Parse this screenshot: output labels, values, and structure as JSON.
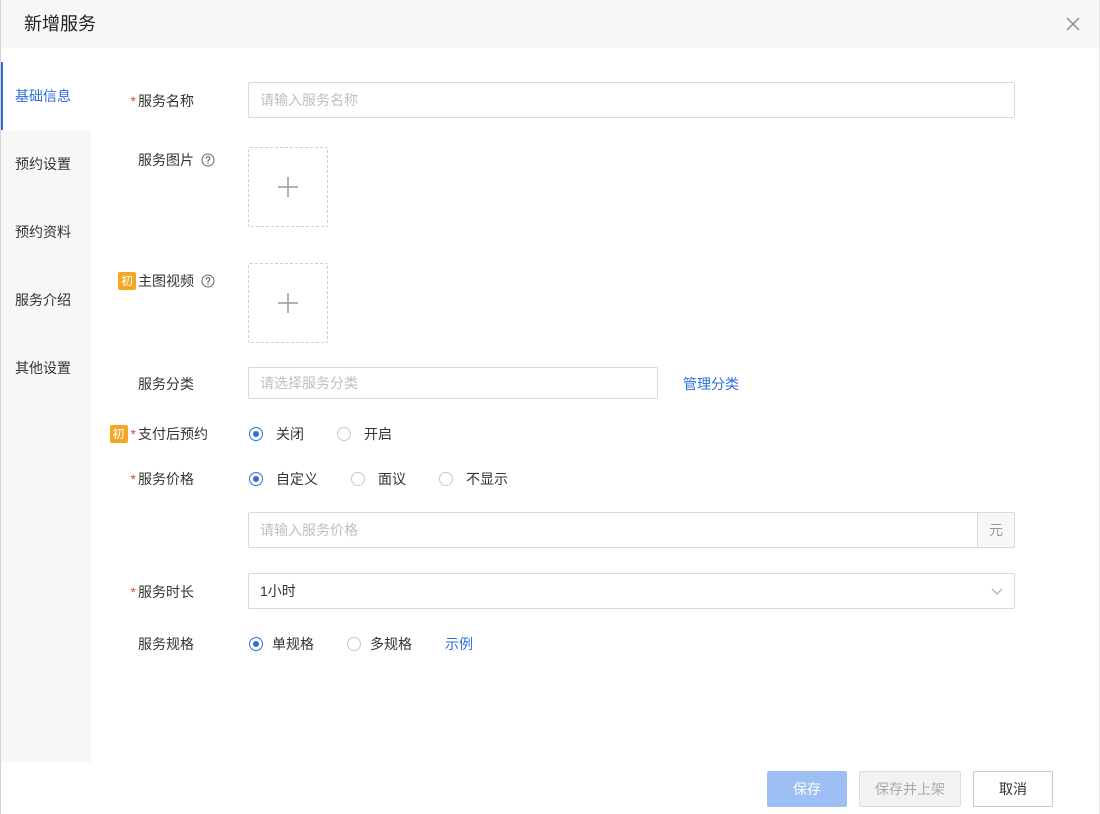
{
  "dialog": {
    "title": "新增服务",
    "close_icon": "close-icon"
  },
  "sidebar": {
    "items": [
      {
        "label": "基础信息",
        "active": true
      },
      {
        "label": "预约设置",
        "active": false
      },
      {
        "label": "预约资料",
        "active": false
      },
      {
        "label": "服务介绍",
        "active": false
      },
      {
        "label": "其他设置",
        "active": false
      }
    ]
  },
  "form": {
    "required_mark": "*",
    "service_name": {
      "label": "服务名称",
      "placeholder": "请输入服务名称",
      "value": ""
    },
    "service_image": {
      "label": "服务图片",
      "help_icon": "question-circle-icon",
      "upload_icon": "plus-icon"
    },
    "main_video": {
      "badge": "初",
      "label": "主图视频",
      "help_icon": "question-circle-icon",
      "upload_icon": "plus-icon"
    },
    "service_category": {
      "label": "服务分类",
      "placeholder": "请选择服务分类",
      "value": "",
      "manage_link": "管理分类"
    },
    "booking_after_payment": {
      "badge": "初",
      "label": "支付后预约",
      "options": [
        {
          "label": "关闭",
          "checked": true
        },
        {
          "label": "开启",
          "checked": false
        }
      ]
    },
    "service_price": {
      "label": "服务价格",
      "options": [
        {
          "label": "自定义",
          "checked": true
        },
        {
          "label": "面议",
          "checked": false
        },
        {
          "label": "不显示",
          "checked": false
        }
      ],
      "placeholder": "请输入服务价格",
      "value": "",
      "unit": "元"
    },
    "service_duration": {
      "label": "服务时长",
      "value": "1小时",
      "dropdown_icon": "chevron-down-icon"
    },
    "service_spec": {
      "label": "服务规格",
      "options": [
        {
          "label": "单规格",
          "checked": true
        },
        {
          "label": "多规格",
          "checked": false
        }
      ],
      "example_link": "示例"
    }
  },
  "footer": {
    "save": {
      "label": "保存",
      "disabled": true
    },
    "save_and_publish": {
      "label": "保存并上架",
      "disabled": true
    },
    "cancel": {
      "label": "取消",
      "disabled": false
    }
  },
  "colors": {
    "primary": "#2d6ede",
    "required": "#e5493a",
    "badge": "#f5a623",
    "primary_disabled": "#9dbff3"
  }
}
